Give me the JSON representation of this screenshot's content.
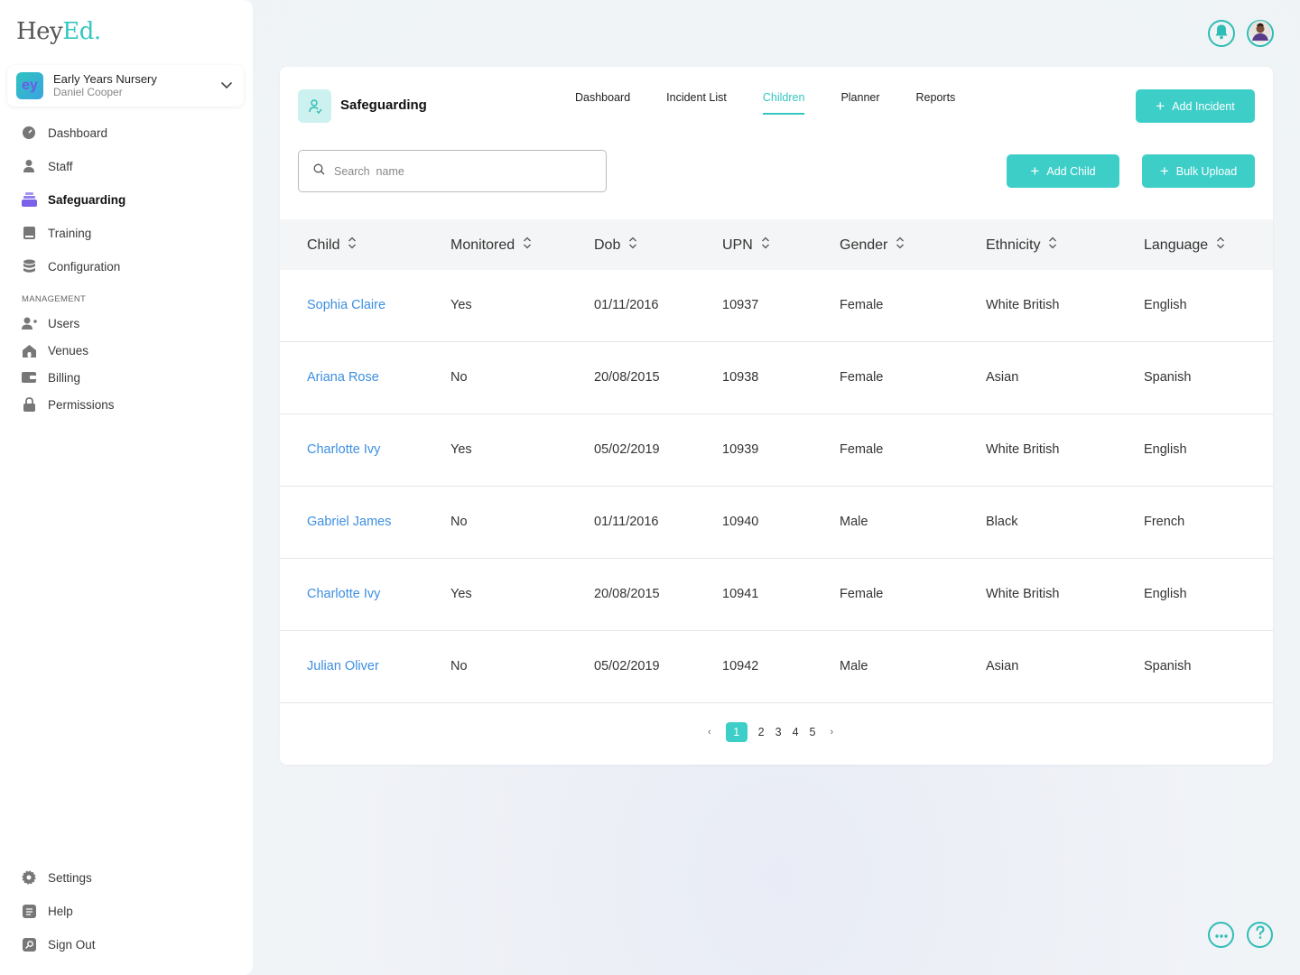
{
  "app": {
    "logo_main": "Hey",
    "logo_accent": "Ed."
  },
  "org": {
    "avatar": "ey",
    "name": "Early Years Nursery",
    "user": "Daniel Cooper"
  },
  "sidebar": {
    "main": [
      {
        "label": "Dashboard",
        "icon": "dashboard-icon"
      },
      {
        "label": "Staff",
        "icon": "person-icon"
      },
      {
        "label": "Safeguarding",
        "icon": "safeguarding-icon",
        "active": true
      },
      {
        "label": "Training",
        "icon": "book-icon"
      },
      {
        "label": "Configuration",
        "icon": "database-icon"
      }
    ],
    "management_label": "MANAGEMENT",
    "management": [
      {
        "label": "Users",
        "icon": "add-user-icon"
      },
      {
        "label": "Venues",
        "icon": "home-icon"
      },
      {
        "label": "Billing",
        "icon": "wallet-icon"
      },
      {
        "label": "Permissions",
        "icon": "lock-icon"
      }
    ],
    "bottom": [
      {
        "label": "Settings",
        "icon": "gear-icon"
      },
      {
        "label": "Help",
        "icon": "help-doc-icon"
      },
      {
        "label": "Sign Out",
        "icon": "sign-out-icon"
      }
    ]
  },
  "header": {
    "module_title": "Safeguarding",
    "tabs": [
      "Dashboard",
      "Incident List",
      "Children",
      "Planner",
      "Reports"
    ],
    "active_tab": "Children",
    "add_incident_label": "Add Incident"
  },
  "toolbar": {
    "search_placeholder": "Search  name",
    "add_child_label": "Add Child",
    "bulk_upload_label": "Bulk Upload"
  },
  "table": {
    "columns": [
      "Child",
      "Monitored",
      "Dob",
      "UPN",
      "Gender",
      "Ethnicity",
      "Language"
    ],
    "rows": [
      [
        "Sophia Claire",
        "Yes",
        "01/11/2016",
        "10937",
        "Female",
        "White British",
        "English"
      ],
      [
        "Ariana Rose",
        "No",
        "20/08/2015",
        "10938",
        "Female",
        "Asian",
        "Spanish"
      ],
      [
        "Charlotte Ivy",
        "Yes",
        "05/02/2019",
        "10939",
        "Female",
        "White British",
        "English"
      ],
      [
        "Gabriel James",
        "No",
        "01/11/2016",
        "10940",
        "Male",
        "Black",
        "French"
      ],
      [
        "Charlotte Ivy",
        "Yes",
        "20/08/2015",
        "10941",
        "Female",
        "White British",
        "English"
      ],
      [
        "Julian Oliver",
        "No",
        "05/02/2019",
        "10942",
        "Male",
        "Asian",
        "Spanish"
      ]
    ]
  },
  "pagination": {
    "pages": [
      "1",
      "2",
      "3",
      "4",
      "5"
    ],
    "current": "1",
    "prev": "‹",
    "next": "›"
  },
  "colors": {
    "accent": "#3ecec8",
    "link": "#3d8fe0",
    "active_nav_icon": "#7b61e8"
  }
}
